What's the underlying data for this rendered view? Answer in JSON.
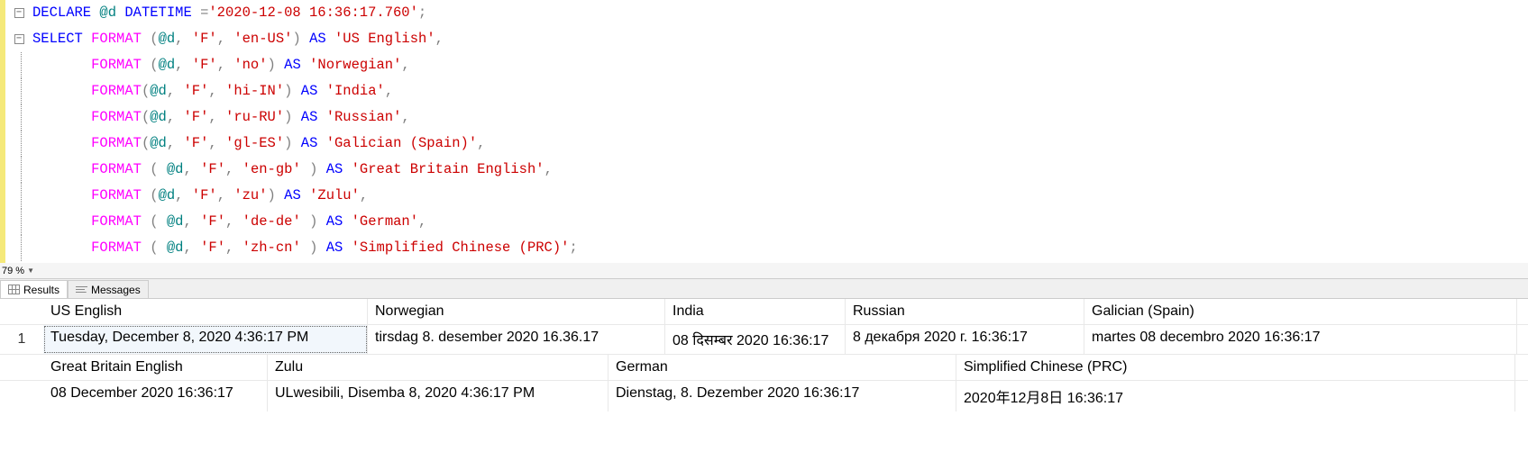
{
  "zoom": "79 %",
  "tabs": {
    "results": "Results",
    "messages": "Messages"
  },
  "code": {
    "l1": {
      "declare": "DECLARE",
      "var": " @d ",
      "type": "DATETIME ",
      "eq": "=",
      "lit": "'2020-12-08 16:36:17.760'",
      "semi": ";"
    },
    "select": "SELECT",
    "format": "FORMAT",
    "as": "AS",
    "var": "@d",
    "comma": ",",
    "semi": ";",
    "lp": "(",
    "rp": ")",
    "spc": " ",
    "fmtF": "'F'",
    "args": {
      "r2": {
        "loc": "'en-US'",
        "alias": "'US English'"
      },
      "r3": {
        "loc": "'no'",
        "alias": "'Norwegian'"
      },
      "r4": {
        "loc": "'hi-IN'",
        "alias": "'India'"
      },
      "r5": {
        "loc": "'ru-RU'",
        "alias": "'Russian'"
      },
      "r6": {
        "loc": "'gl-ES'",
        "alias": "'Galician (Spain)'"
      },
      "r7": {
        "loc": "'en-gb'",
        "alias": "'Great Britain English'"
      },
      "r8": {
        "loc": "'zu'",
        "alias": "'Zulu'"
      },
      "r9": {
        "loc": "'de-de'",
        "alias": "'German'"
      },
      "r10": {
        "loc": "'zh-cn'",
        "alias": "'Simplified Chinese (PRC)'"
      }
    }
  },
  "resultsA": {
    "headers": [
      "US English",
      "Norwegian",
      "India",
      "Russian",
      "Galician (Spain)"
    ],
    "rownum": "1",
    "cells": [
      "Tuesday, December 8, 2020 4:36:17 PM",
      "tirsdag 8. desember 2020 16.36.17",
      "08 दिसम्बर 2020 16:36:17",
      "8 декабря 2020 г. 16:36:17",
      "martes 08 decembro 2020 16:36:17"
    ]
  },
  "resultsB": {
    "headers": [
      "Great Britain English",
      "Zulu",
      "German",
      "Simplified Chinese (PRC)"
    ],
    "cells": [
      "08 December 2020 16:36:17",
      "ULwesibili, Disemba 8, 2020 4:36:17 PM",
      "Dienstag, 8. Dezember 2020 16:36:17",
      "2020年12月8日 16:36:17"
    ]
  }
}
